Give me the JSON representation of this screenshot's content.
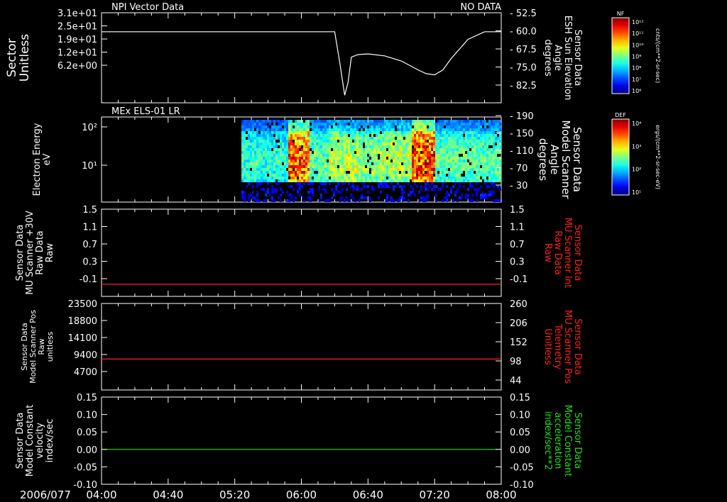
{
  "footer": {
    "date_label": "2006/077"
  },
  "time_axis": {
    "ticks": [
      "04:00",
      "04:40",
      "05:20",
      "06:00",
      "06:40",
      "07:20",
      "08:00"
    ],
    "range": [
      "04:00",
      "08:00"
    ]
  },
  "colors": {
    "white": "#ffffff",
    "red": "#ff2020",
    "green": "#20e020",
    "bg": "#000000"
  },
  "panels": [
    {
      "id": "npi",
      "title": "NPI Vector Data",
      "status": "NO DATA",
      "left_label": [
        "Sector",
        "Unitless"
      ],
      "right_label": [
        "Sensor Data",
        "ESH Sun Elevation",
        "Angle",
        "degrees"
      ],
      "left_ticks": [
        "3.1e+01",
        "2.5e+01",
        "1.9e+01",
        "1.2e+01",
        "6.2e+00"
      ],
      "right_ticks": [
        "-52.5",
        "-60.0",
        "-67.5",
        "-75.0",
        "-82.5"
      ]
    },
    {
      "id": "els",
      "title": "MEx ELS-01 LR",
      "left_label": [
        "Electron Energy",
        "eV"
      ],
      "right_label": [
        "Sensor Data",
        "Model Scanner",
        "Angle",
        "degrees"
      ],
      "left_ticks": [
        "10²",
        "10¹"
      ],
      "right_ticks": [
        "190",
        "150",
        "110",
        "70",
        "30"
      ]
    },
    {
      "id": "mu30",
      "left_label": [
        "Sensor Data",
        "MU Scanner +30V",
        "Raw Data",
        "Raw"
      ],
      "right_label": [
        "Sensor Data",
        "MU Scanner Int",
        "Raw Data",
        "Raw"
      ],
      "left_ticks": [
        "1.5",
        "1.1",
        "0.7",
        "0.3",
        "-0.1"
      ],
      "right_ticks": [
        "1.5",
        "1.1",
        "0.7",
        "0.3",
        "-0.1"
      ]
    },
    {
      "id": "pos",
      "left_label": [
        "Sensor Data",
        "Model Scanner Pos",
        "Raw",
        "unitless"
      ],
      "right_label": [
        "Sensor Data",
        "MU Scanner Pos",
        "Telemetry",
        "Unitless"
      ],
      "left_ticks": [
        "23500",
        "18800",
        "14100",
        "9400",
        "4700"
      ],
      "right_ticks": [
        "260",
        "206",
        "152",
        "98",
        "44"
      ]
    },
    {
      "id": "const",
      "left_label": [
        "Sensor Data",
        "Model Constant",
        "velocity",
        "index/sec"
      ],
      "right_label": [
        "Sensor Data",
        "Model Constant",
        "acceleration",
        "index/sec**2"
      ],
      "left_ticks": [
        "0.15",
        "0.10",
        "0.05",
        "0.00",
        "-0.05",
        "-0.10"
      ],
      "right_ticks": [
        "0.15",
        "0.10",
        "0.05",
        "0.00",
        "-0.05",
        "-0.10"
      ]
    }
  ],
  "colorbars": [
    {
      "title": "NF",
      "unit": "cnts/(cm**2-sr-sec)",
      "ticks": [
        "10¹²",
        "10¹¹",
        "10¹⁰",
        "10⁹",
        "10⁸",
        "10⁷",
        "10⁶"
      ]
    },
    {
      "title": "DEF",
      "unit": "ergs/(cm**2-sr-sec-eV)",
      "ticks": [
        "10⁴",
        "10³",
        "10²",
        "10¹"
      ]
    }
  ],
  "chart_data": [
    {
      "type": "line",
      "panel": "npi",
      "series_axis": "right",
      "ylim": [
        -88,
        -52.5
      ],
      "x": [
        "04:00",
        "06:00",
        "06:10",
        "06:20",
        "06:23",
        "06:26",
        "06:28",
        "06:30",
        "06:34",
        "06:40",
        "06:50",
        "07:00",
        "07:10",
        "07:15",
        "07:20",
        "07:25",
        "07:30",
        "07:40",
        "07:50",
        "08:00"
      ],
      "y": [
        -60.0,
        -60.0,
        -60.0,
        -60.0,
        -72.0,
        -85.0,
        -80.0,
        -70.0,
        -69.0,
        -68.7,
        -69.5,
        -71.5,
        -75.0,
        -76.5,
        -77.0,
        -75.0,
        -70.5,
        -63.0,
        -60.0,
        -60.0
      ]
    },
    {
      "type": "heatmap",
      "panel": "els",
      "x_start": "05:24",
      "x_end": "08:00",
      "yscale": "log",
      "ylabel": "Electron Energy",
      "bands": [
        {
          "t0": "05:24",
          "t1": "05:52",
          "level": 0.45
        },
        {
          "t0": "05:52",
          "t1": "06:04",
          "level": 0.85
        },
        {
          "t0": "06:04",
          "t1": "06:16",
          "level": 0.5
        },
        {
          "t0": "06:16",
          "t1": "06:34",
          "level": 0.6
        },
        {
          "t0": "06:34",
          "t1": "06:48",
          "level": 0.55
        },
        {
          "t0": "06:48",
          "t1": "07:06",
          "level": 0.6
        },
        {
          "t0": "07:06",
          "t1": "07:20",
          "level": 0.9
        },
        {
          "t0": "07:20",
          "t1": "08:00",
          "level": 0.5
        }
      ]
    },
    {
      "type": "line",
      "panel": "mu30",
      "ylim": [
        -0.3,
        1.5
      ],
      "x": [
        "04:00",
        "08:00"
      ],
      "y": [
        -0.05,
        -0.05
      ],
      "color": "red"
    },
    {
      "type": "line",
      "panel": "pos",
      "ylim": [
        0,
        23500
      ],
      "x": [
        "04:00",
        "08:00"
      ],
      "y": [
        8400,
        8400
      ],
      "color": "red"
    },
    {
      "type": "line",
      "panel": "const",
      "ylim": [
        -0.1,
        0.15
      ],
      "x": [
        "04:00",
        "08:00"
      ],
      "y": [
        0.0,
        0.0
      ],
      "color": "green"
    }
  ]
}
